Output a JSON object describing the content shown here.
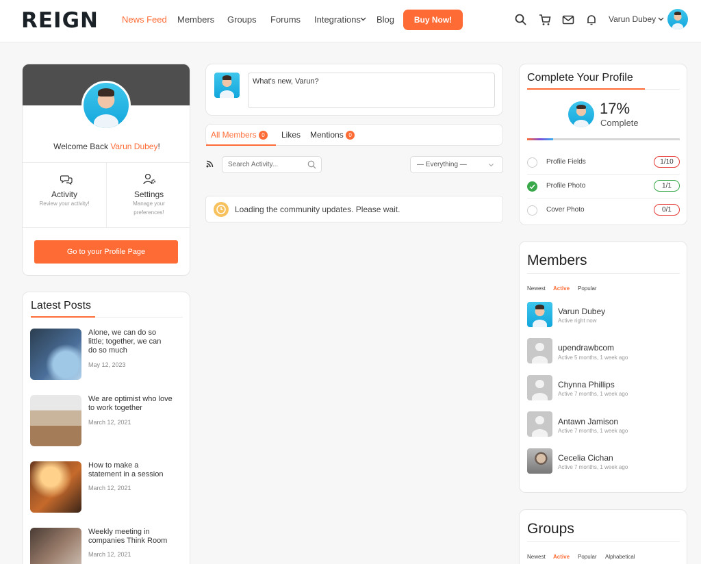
{
  "header": {
    "logo": "REIGN",
    "nav": [
      "News Feed",
      "Members",
      "Groups",
      "Forums",
      "Integrations",
      "Blog"
    ],
    "buy_label": "Buy Now!",
    "user_name": "Varun Dubey",
    "accent": "#ff6b35"
  },
  "profile_card": {
    "welcome_prefix": "Welcome Back ",
    "welcome_name": "Varun Dubey",
    "welcome_suffix": "!",
    "activity_title": "Activity",
    "activity_sub": "Review your activity!",
    "settings_title": "Settings",
    "settings_sub_1": "Manage your",
    "settings_sub_2": "preferences!",
    "button_label": "Go to your Profile Page"
  },
  "latest_posts": {
    "title": "Latest Posts",
    "posts": [
      {
        "lines": [
          "Alone, we can do so",
          "little; together, we can",
          "do so much"
        ],
        "date": "May 12, 2023"
      },
      {
        "lines": [
          "We are optimist who love",
          "to work together"
        ],
        "date": "March 12, 2021"
      },
      {
        "lines": [
          "How to make a",
          "statement in a session"
        ],
        "date": "March 12, 2021"
      },
      {
        "lines": [
          "Weekly meeting in",
          "companies Think Room"
        ],
        "date": "March 12, 2021"
      }
    ]
  },
  "composer": {
    "placeholder": "What's new, Varun?"
  },
  "feed_tabs": {
    "all_members": "All Members",
    "all_count": "0",
    "likes": "Likes",
    "mentions": "Mentions",
    "mentions_count": "0"
  },
  "filters": {
    "search_placeholder": "Search Activity...",
    "select_value": "— Everything —"
  },
  "loading_text": "Loading the community updates. Please wait.",
  "complete_profile": {
    "title": "Complete Your Profile",
    "percent": "17%",
    "percent_label": "Complete",
    "progress": 0.17,
    "items": [
      {
        "label": "Profile Fields",
        "count": "1/10",
        "done": false
      },
      {
        "label": "Profile Photo",
        "count": "1/1",
        "done": true
      },
      {
        "label": "Cover Photo",
        "count": "0/1",
        "done": false
      }
    ]
  },
  "members": {
    "title": "Members",
    "tabs": [
      "Newest",
      "Active",
      "Popular"
    ],
    "list": [
      {
        "name": "Varun Dubey",
        "status": "Active right now"
      },
      {
        "name": "upendrawbcom",
        "status": "Active 5 months, 1 week ago"
      },
      {
        "name": "Chynna Phillips",
        "status": "Active 7 months, 1 week ago"
      },
      {
        "name": "Antawn Jamison",
        "status": "Active 7 months, 1 week ago"
      },
      {
        "name": "Cecelia Cichan",
        "status": "Active 7 months, 1 week ago"
      }
    ]
  },
  "groups": {
    "title": "Groups",
    "tabs": [
      "Newest",
      "Active",
      "Popular",
      "Alphabetical"
    ]
  }
}
